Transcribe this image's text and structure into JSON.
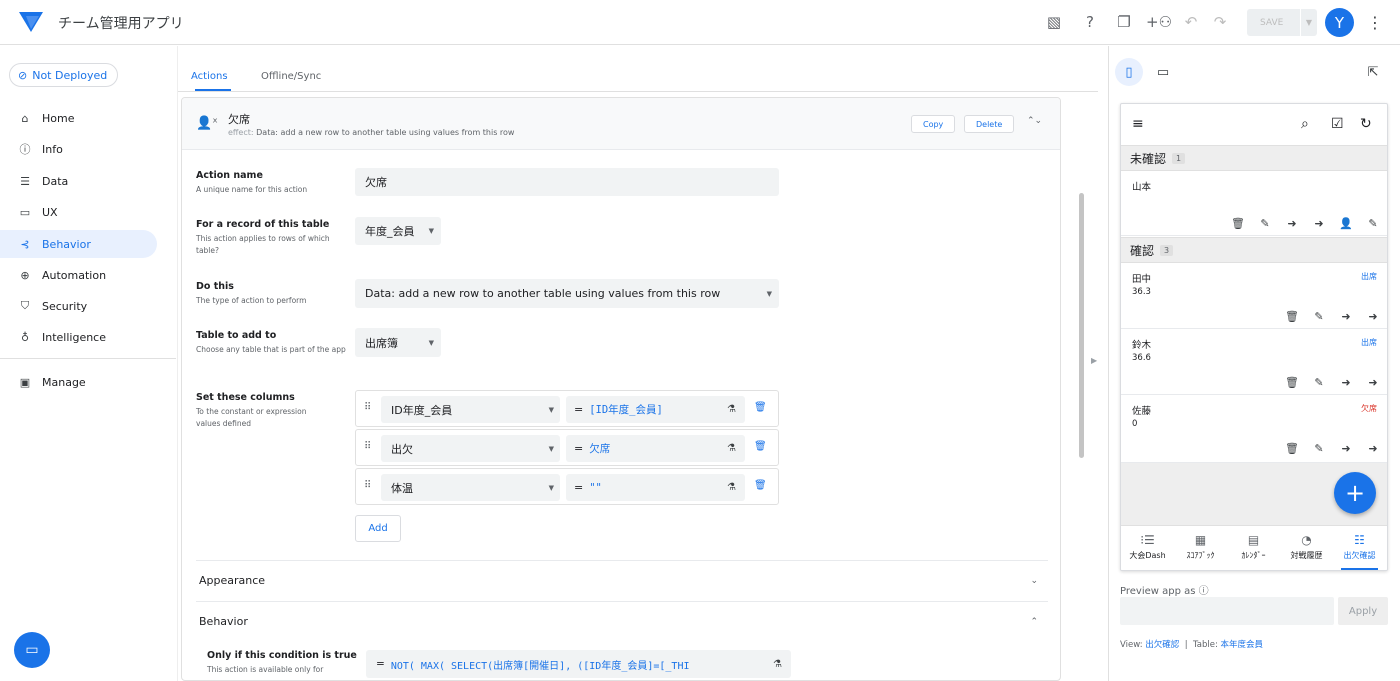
{
  "app": {
    "title": "チーム管理用アプリ",
    "save_label": "SAVE",
    "avatar_letter": "Y",
    "brand_color": "#1a73e8"
  },
  "sidebar": {
    "deploy_status": "Not Deployed",
    "items": [
      {
        "label": "Home",
        "icon": "home-icon"
      },
      {
        "label": "Info",
        "icon": "info-icon"
      },
      {
        "label": "Data",
        "icon": "data-icon"
      },
      {
        "label": "UX",
        "icon": "ux-icon"
      },
      {
        "label": "Behavior",
        "icon": "behavior-icon",
        "active": true
      },
      {
        "label": "Automation",
        "icon": "robot-icon"
      },
      {
        "label": "Security",
        "icon": "shield-icon"
      },
      {
        "label": "Intelligence",
        "icon": "lightbulb-icon"
      }
    ],
    "manage_label": "Manage"
  },
  "tabs": [
    {
      "label": "Actions",
      "active": true
    },
    {
      "label": "Offline/Sync"
    }
  ],
  "action": {
    "title": "欠席",
    "effect_label": "effect:",
    "effect_text": "Data: add a new row to another table using values from this row",
    "copy_label": "Copy",
    "delete_label": "Delete",
    "fields": {
      "name": {
        "label": "Action name",
        "desc": "A unique name for this action",
        "value": "欠席"
      },
      "table": {
        "label": "For a record of this table",
        "desc": "This action applies to rows of which table?",
        "value": "年度_会員"
      },
      "do_this": {
        "label": "Do this",
        "desc": "The type of action to perform",
        "value": "Data: add a new row to another table using values from this row"
      },
      "table_add": {
        "label": "Table to add to",
        "desc": "Choose any table that is part of the app",
        "value": "出席簿"
      },
      "set_columns": {
        "label": "Set these columns",
        "desc": "To the constant or expression values defined"
      }
    },
    "columns": [
      {
        "column": "ID年度_会員",
        "expr": "[ID年度_会員]"
      },
      {
        "column": "出欠",
        "expr": "欠席"
      },
      {
        "column": "体温",
        "expr": "\"\""
      }
    ],
    "eq_sign": "=",
    "add_label": "Add",
    "appearance_label": "Appearance",
    "behavior_label": "Behavior",
    "condition": {
      "label": "Only if this condition is true",
      "desc": "This action is available only for",
      "expr": "NOT(  MAX(    SELECT(出席簿[開催日], ([ID年度_会員]=[_THI"
    }
  },
  "preview": {
    "groups": [
      {
        "name": "未確認",
        "count": "1",
        "rows": [
          {
            "name": "山本",
            "value": "",
            "status": ""
          }
        ]
      },
      {
        "name": "確認",
        "count": "3",
        "rows": [
          {
            "name": "田中",
            "value": "36.3",
            "status": "出席",
            "status_color": "#1a73e8"
          },
          {
            "name": "鈴木",
            "value": "36.6",
            "status": "出席",
            "status_color": "#1a73e8"
          },
          {
            "name": "佐藤",
            "value": "0",
            "status": "欠席",
            "status_color": "#d93025"
          }
        ]
      }
    ],
    "nav": [
      {
        "label": "大会Dash",
        "icon": "list-numbered-icon"
      },
      {
        "label": "ｽｺｱﾌﾞｯｸ",
        "icon": "table-icon"
      },
      {
        "label": "ｶﾚﾝﾀﾞｰ",
        "icon": "calendar-icon"
      },
      {
        "label": "対戦履歴",
        "icon": "chart-icon"
      },
      {
        "label": "出欠確認",
        "icon": "list-icon",
        "active": true
      }
    ],
    "preview_as_label": "Preview app as",
    "apply_label": "Apply",
    "view_label": "View:",
    "view_value": "出欠確認",
    "sep": "|",
    "table_label": "Table:",
    "table_value": "本年度会員"
  }
}
